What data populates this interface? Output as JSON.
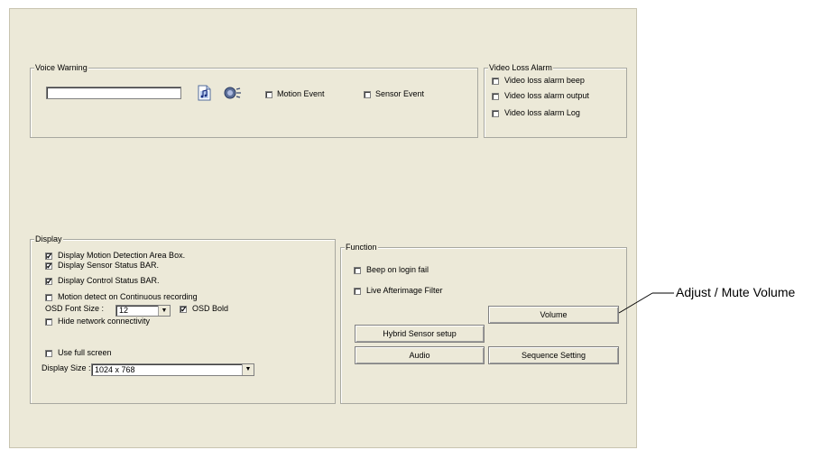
{
  "voice_warning": {
    "title": "Voice Warning",
    "sound_field_value": "",
    "music_icon": "music-file-icon",
    "speaker_icon": "speaker-icon",
    "motion_event": {
      "label": "Motion Event",
      "checked": false
    },
    "sensor_event": {
      "label": "Sensor Event",
      "checked": false
    }
  },
  "video_loss_alarm": {
    "title": "Video Loss Alarm",
    "items": [
      {
        "label": "Video loss alarm beep",
        "checked": false
      },
      {
        "label": "Video loss alarm output",
        "checked": false
      },
      {
        "label": "Video loss alarm Log",
        "checked": false
      }
    ]
  },
  "display": {
    "title": "Display",
    "motion_area_box": {
      "label": "Display Motion Detection Area Box.",
      "checked": true
    },
    "sensor_status_bar": {
      "label": "Display Sensor Status BAR.",
      "checked": true
    },
    "control_status_bar": {
      "label": "Display Control Status BAR.",
      "checked": true
    },
    "motion_detect_continuous": {
      "label": "Motion detect on Continuous recording",
      "checked": false
    },
    "osd_font_size_label": "OSD Font Size :",
    "osd_font_size_value": "12",
    "osd_bold": {
      "label": "OSD Bold",
      "checked": true
    },
    "hide_network": {
      "label": "Hide network connectivity",
      "checked": false
    },
    "use_full_screen": {
      "label": "Use full screen",
      "checked": false
    },
    "display_size_label": "Display Size :",
    "display_size_value": "1024 x 768"
  },
  "function": {
    "title": "Function",
    "beep_login_fail": {
      "label": "Beep on login fail",
      "checked": false
    },
    "live_afterimage": {
      "label": "Live Afterimage Filter",
      "checked": false
    },
    "volume_button": "Volume",
    "hybrid_sensor_button": "Hybrid Sensor setup",
    "audio_button": "Audio",
    "sequence_button": "Sequence Setting"
  },
  "callout": {
    "text": "Adjust / Mute Volume"
  }
}
